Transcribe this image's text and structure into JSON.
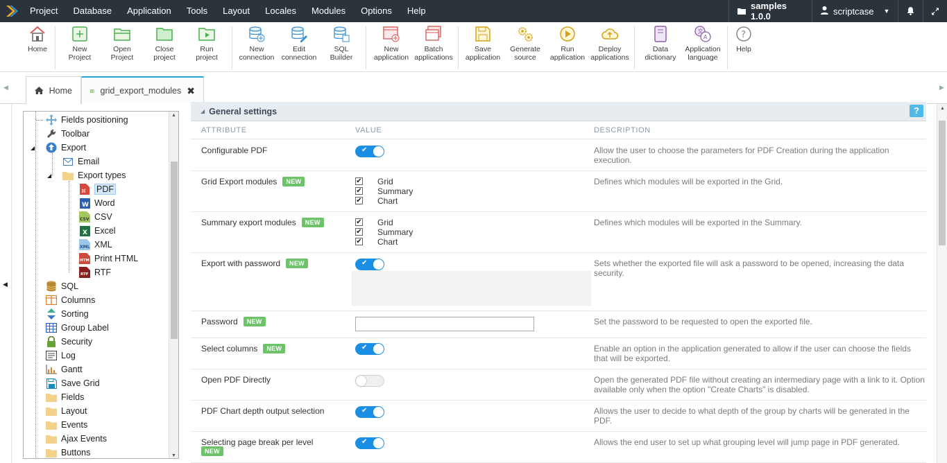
{
  "menubar": {
    "items": [
      "Project",
      "Database",
      "Application",
      "Tools",
      "Layout",
      "Locales",
      "Modules",
      "Options",
      "Help"
    ],
    "project_label": "samples 1.0.0",
    "user_label": "scriptcase"
  },
  "toolbar": {
    "buttons": [
      {
        "label": "Home"
      },
      {
        "label": "New\nProject"
      },
      {
        "label": "Open\nProject"
      },
      {
        "label": "Close\nproject"
      },
      {
        "label": "Run\nproject"
      },
      {
        "label": "New\nconnection"
      },
      {
        "label": "Edit\nconnection"
      },
      {
        "label": "SQL\nBuilder"
      },
      {
        "label": "New\napplication"
      },
      {
        "label": "Batch\napplications"
      },
      {
        "label": "Save\napplication"
      },
      {
        "label": "Generate\nsource"
      },
      {
        "label": "Run\napplication"
      },
      {
        "label": "Deploy\napplications"
      },
      {
        "label": "Data\ndictionary"
      },
      {
        "label": "Application\nlanguage"
      },
      {
        "label": "Help"
      }
    ]
  },
  "tabs": [
    {
      "label": "Home"
    },
    {
      "label": "grid_export_modules"
    }
  ],
  "tree": {
    "items": [
      {
        "label": "Fields positioning"
      },
      {
        "label": "Toolbar"
      },
      {
        "label": "Export"
      },
      {
        "label": "Email"
      },
      {
        "label": "Export types"
      },
      {
        "label": "PDF"
      },
      {
        "label": "Word"
      },
      {
        "label": "CSV"
      },
      {
        "label": "Excel"
      },
      {
        "label": "XML"
      },
      {
        "label": "Print HTML"
      },
      {
        "label": "RTF"
      },
      {
        "label": "SQL"
      },
      {
        "label": "Columns"
      },
      {
        "label": "Sorting"
      },
      {
        "label": "Group Label"
      },
      {
        "label": "Security"
      },
      {
        "label": "Log"
      },
      {
        "label": "Gantt"
      },
      {
        "label": "Save Grid"
      },
      {
        "label": "Fields"
      },
      {
        "label": "Layout"
      },
      {
        "label": "Events"
      },
      {
        "label": "Ajax Events"
      },
      {
        "label": "Buttons"
      }
    ]
  },
  "section": {
    "title": "General settings",
    "help": "?",
    "col_attribute": "ATTRIBUTE",
    "col_value": "VALUE",
    "col_description": "DESCRIPTION",
    "badge_new": "NEW"
  },
  "rows": [
    {
      "attr": "Configurable PDF",
      "desc": "Allow the user to choose the parameters for PDF Creation during the application execution."
    },
    {
      "attr": "Grid Export modules",
      "desc": "Defines which modules will be exported in the Grid.",
      "options": [
        "Grid",
        "Summary",
        "Chart"
      ]
    },
    {
      "attr": "Summary export modules",
      "desc": "Defines which modules will be exported in the Summary.",
      "options": [
        "Grid",
        "Summary",
        "Chart"
      ]
    },
    {
      "attr": "Export with password",
      "desc": "Sets whether the exported file will ask a password to be opened, increasing the data security."
    },
    {
      "attr": "Password",
      "desc": "Set the password to be requested to open the exported file.",
      "value": ""
    },
    {
      "attr": "Select columns",
      "desc": "Enable an option in the application generated to allow if the user can choose the fields that will be exported."
    },
    {
      "attr": "Open PDF Directly",
      "desc": "Open the generated PDF file without creating an intermediary page with a link to it. Option available only when the option \"Create Charts\" is disabled."
    },
    {
      "attr": "PDF Chart depth output selection",
      "desc": "Allows the user to decide to what depth of the group by charts will be generated in the PDF."
    },
    {
      "attr": "Selecting page break per level",
      "desc": "Allows the end user to set up what grouping level will jump page in PDF generated."
    }
  ],
  "toggle_check": "✔"
}
